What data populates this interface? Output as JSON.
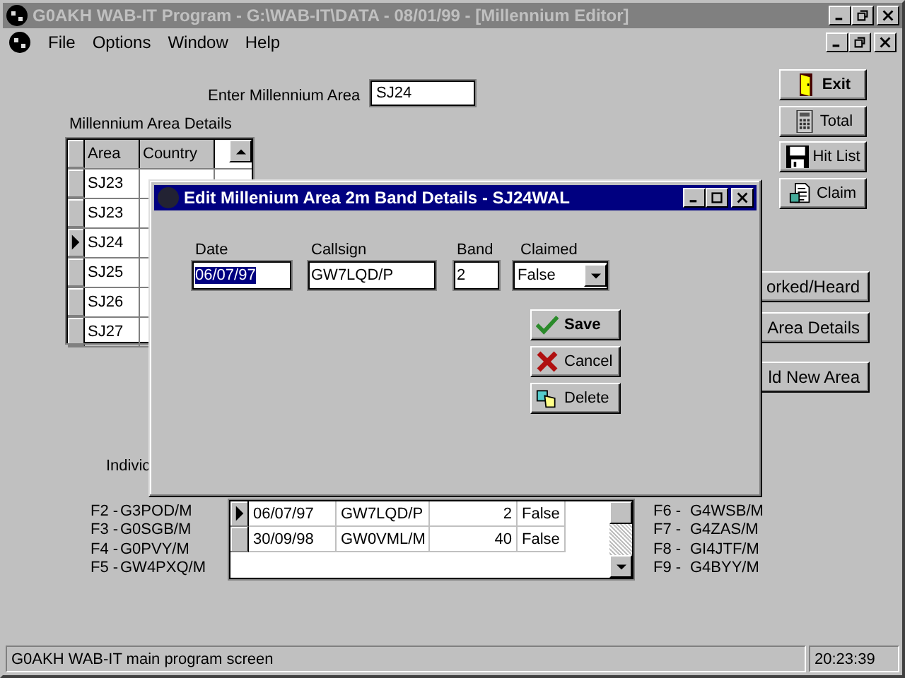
{
  "window": {
    "title": "G0AKH WAB-IT Program - G:\\WAB-IT\\DATA - 08/01/99 - [Millennium Editor]"
  },
  "menu": [
    "File",
    "Options",
    "Window",
    "Help"
  ],
  "area_field": {
    "label": "Enter Millennium Area",
    "value": "SJ24"
  },
  "area_details": {
    "label": "Millennium Area Details",
    "columns": [
      "Area",
      "Country"
    ],
    "rows": [
      {
        "area": "SJ23",
        "selected": false
      },
      {
        "area": "SJ23",
        "selected": false
      },
      {
        "area": "SJ24",
        "selected": true
      },
      {
        "area": "SJ25",
        "selected": false
      },
      {
        "area": "SJ26",
        "selected": false
      },
      {
        "area": "SJ27",
        "selected": false
      }
    ]
  },
  "side_buttons": [
    {
      "label": "Exit",
      "kind": "exit"
    },
    {
      "label": "Total",
      "kind": "total"
    },
    {
      "label": "Hit List",
      "kind": "hitlist"
    },
    {
      "label": "Claim",
      "kind": "claim"
    }
  ],
  "partial_buttons": [
    "orked/Heard",
    "Area Details",
    "ld New Area"
  ],
  "individual_label": "Indivic",
  "shortcuts_left": [
    {
      "key": "F2 -",
      "call": "G3POD/M"
    },
    {
      "key": "F3 -",
      "call": "G0SGB/M"
    },
    {
      "key": "F4 -",
      "call": "G0PVY/M"
    },
    {
      "key": "F5 -",
      "call": "GW4PXQ/M"
    }
  ],
  "shortcuts_right": [
    {
      "key": "F6 -",
      "call": "G4WSB/M"
    },
    {
      "key": "F7 -",
      "call": "G4ZAS/M"
    },
    {
      "key": "F8 -",
      "call": "GI4JTF/M"
    },
    {
      "key": "F9 -",
      "call": "G4BYY/M"
    }
  ],
  "contacts": {
    "rows": [
      {
        "date": "06/07/97",
        "callsign": "GW7LQD/P",
        "band": "2",
        "claimed": "False",
        "selected": true
      },
      {
        "date": "30/09/98",
        "callsign": "GW0VML/M",
        "band": "40",
        "claimed": "False",
        "selected": false
      }
    ]
  },
  "dialog": {
    "title": "Edit Millenium Area 2m Band Details - SJ24WAL",
    "fields": [
      {
        "label": "Date",
        "value": "06/07/97",
        "selected": true
      },
      {
        "label": "Callsign",
        "value": "GW7LQD/P",
        "selected": false
      },
      {
        "label": "Band",
        "value": "2",
        "selected": false
      }
    ],
    "claimed": {
      "label": "Claimed",
      "value": "False"
    },
    "buttons": [
      {
        "label": "Save",
        "kind": "save"
      },
      {
        "label": "Cancel",
        "kind": "cancel"
      },
      {
        "label": "Delete",
        "kind": "delete"
      }
    ]
  },
  "status_bar": {
    "message": "G0AKH WAB-IT main program screen",
    "time": "20:23:39"
  }
}
